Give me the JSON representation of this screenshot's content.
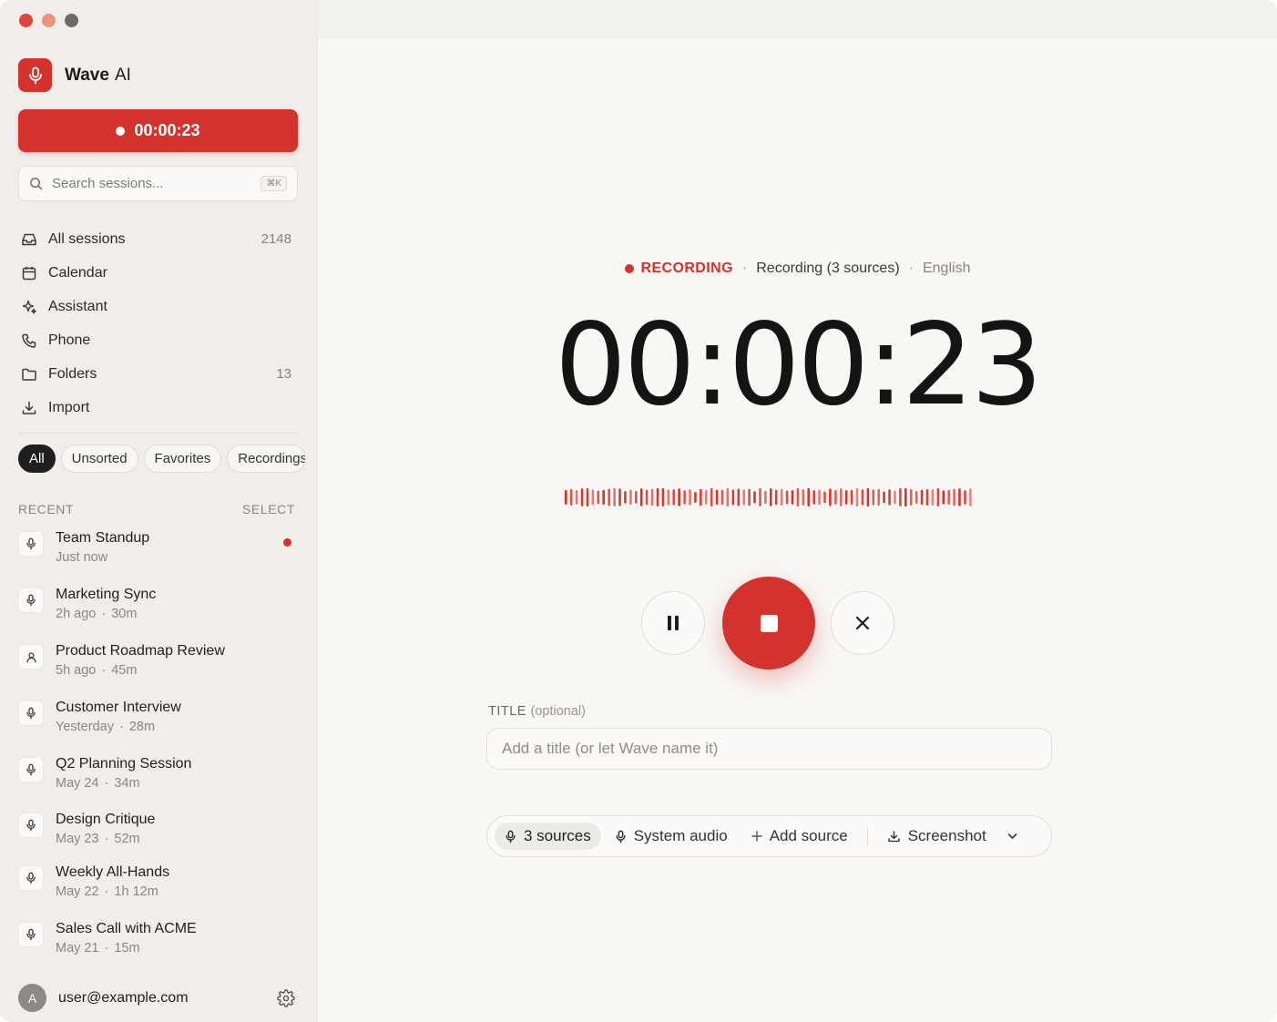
{
  "app": {
    "name": "Wave",
    "name_suffix": "AI"
  },
  "sidebar": {
    "record_button": {
      "time": "00:00:23"
    },
    "search": {
      "placeholder": "Search sessions...",
      "shortcut": "⌘K"
    },
    "nav": [
      {
        "label": "All sessions",
        "count": "2148",
        "icon": "inbox-icon"
      },
      {
        "label": "Calendar",
        "count": "",
        "icon": "calendar-icon"
      },
      {
        "label": "Assistant",
        "count": "",
        "icon": "sparkle-icon"
      },
      {
        "label": "Phone",
        "count": "",
        "icon": "phone-icon"
      },
      {
        "label": "Folders",
        "count": "13",
        "icon": "folder-icon"
      },
      {
        "label": "Import",
        "count": "",
        "icon": "download-icon"
      }
    ],
    "filters": [
      "All",
      "Unsorted",
      "Favorites",
      "Recordings"
    ],
    "recent_label": "RECENT",
    "select_label": "SELECT",
    "sessions": [
      {
        "title": "Team Standup",
        "when": "Just now",
        "duration": "",
        "icon": "mic-icon",
        "live": true
      },
      {
        "title": "Marketing Sync",
        "when": "2h ago",
        "duration": "30m",
        "icon": "mic-icon",
        "live": false
      },
      {
        "title": "Product Roadmap Review",
        "when": "5h ago",
        "duration": "45m",
        "icon": "person-icon",
        "live": false
      },
      {
        "title": "Customer Interview",
        "when": "Yesterday",
        "duration": "28m",
        "icon": "mic-icon",
        "live": false
      },
      {
        "title": "Q2 Planning Session",
        "when": "May 24",
        "duration": "34m",
        "icon": "mic-icon",
        "live": false
      },
      {
        "title": "Design Critique",
        "when": "May 23",
        "duration": "52m",
        "icon": "mic-icon",
        "live": false
      },
      {
        "title": "Weekly All-Hands",
        "when": "May 22",
        "duration": "1h 12m",
        "icon": "mic-icon",
        "live": false
      },
      {
        "title": "Sales Call with ACME",
        "when": "May 21",
        "duration": "15m",
        "icon": "mic-icon",
        "live": false
      }
    ],
    "user": {
      "initial": "A",
      "email": "user@example.com"
    }
  },
  "recorder": {
    "status": "RECORDING",
    "sources_text": "Recording (3 sources)",
    "language": "English",
    "timer": "00:00:23",
    "title_label": "TITLE",
    "title_optional": "(optional)",
    "title_placeholder": "Add a title (or let Wave name it)",
    "sources_bar": {
      "sources_count": "3 sources",
      "system_audio": "System audio",
      "add_source": "Add source",
      "screenshot": "Screenshot"
    }
  },
  "colors": {
    "accent": "#d4322c",
    "sidebar_bg": "#f1eeea",
    "main_bg": "#f8f7f4"
  }
}
